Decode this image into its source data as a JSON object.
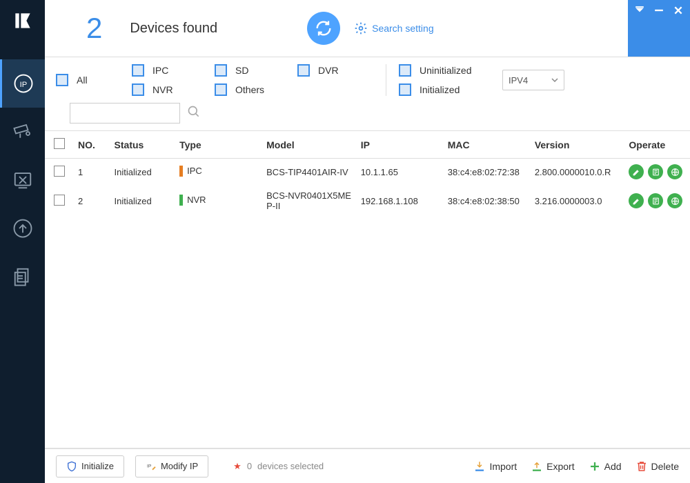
{
  "header": {
    "count": "2",
    "title": "Devices found",
    "search_setting": "Search setting"
  },
  "filters": {
    "all": "All",
    "ipc": "IPC",
    "nvr": "NVR",
    "sd": "SD",
    "others": "Others",
    "dvr": "DVR",
    "uninit": "Uninitialized",
    "init": "Initialized",
    "ipver": "IPV4"
  },
  "columns": {
    "no": "NO.",
    "status": "Status",
    "type": "Type",
    "model": "Model",
    "ip": "IP",
    "mac": "MAC",
    "version": "Version",
    "operate": "Operate"
  },
  "rows": [
    {
      "no": "1",
      "status": "Initialized",
      "type": "IPC",
      "typecolor": "#e67e22",
      "model": "BCS-TIP4401AIR-IV",
      "ip": "10.1.1.65",
      "mac": "38:c4:e8:02:72:38",
      "version": "2.800.0000010.0.R"
    },
    {
      "no": "2",
      "status": "Initialized",
      "type": "NVR",
      "typecolor": "#3fb04f",
      "model": "BCS-NVR0401X5MEP-II",
      "ip": "192.168.1.108",
      "mac": "38:c4:e8:02:38:50",
      "version": "3.216.0000003.0"
    }
  ],
  "footer": {
    "initialize": "Initialize",
    "modifyip": "Modify IP",
    "selcount": "0",
    "selsuffix": "devices selected",
    "import": "Import",
    "export": "Export",
    "add": "Add",
    "delete": "Delete"
  }
}
